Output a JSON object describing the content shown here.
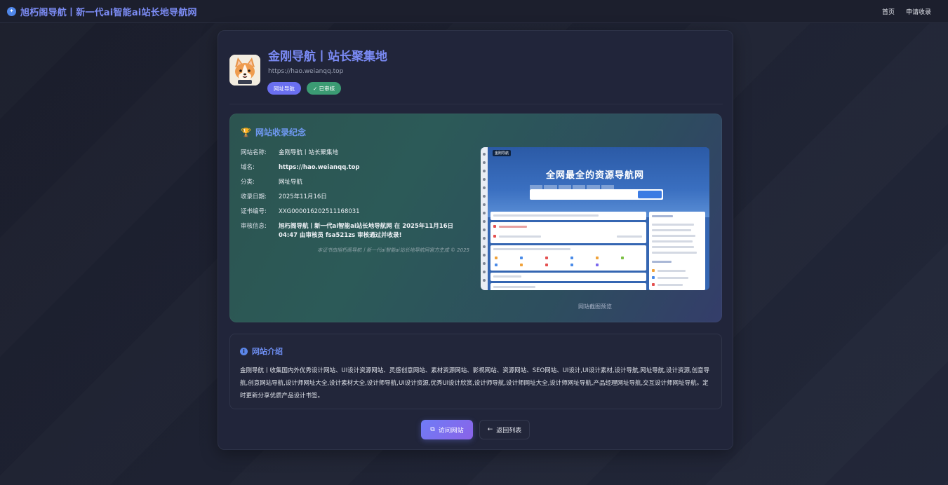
{
  "topbar": {
    "brand": "旭朽阁导航丨新一代ai智能ai站长地导航网",
    "nav": [
      "首页",
      "申请收录"
    ]
  },
  "site": {
    "title": "金刚导航丨站长聚集地",
    "url": "https://hao.weianqq.top",
    "tags": [
      "网址导航",
      "已审核"
    ]
  },
  "certificate": {
    "title": "网站收录纪念",
    "rows": [
      {
        "label": "网站名称:",
        "value": "金刚导航丨站长聚集地"
      },
      {
        "label": "域名:",
        "value": "https://hao.weianqq.top"
      },
      {
        "label": "分类:",
        "value": "网址导航"
      },
      {
        "label": "收录日期:",
        "value": "2025年11月16日"
      },
      {
        "label": "证书编号:",
        "value": "XXG000016202511168031"
      },
      {
        "label": "审核信息:",
        "value": "旭朽阁导航丨新一代ai智能ai站长地导航网 在 2025年11月16日 04:47 由审核员 fsa521zs 审核通过并收录!"
      }
    ],
    "footer": "本证书由旭朽阁导航丨新一代ai智能ai站长地导航网官方生成 © 2025",
    "preview": {
      "logo": "金刚导航",
      "headline": "全网最全的资源导航网",
      "caption": "网站截图预览"
    }
  },
  "intro": {
    "title": "网站介绍",
    "text": "金刚导航丨收集国内外优秀设计网站、UI设计资源网站、灵感创意网站、素材资源网站、影视网站、资源网站、SEO网站、UI设计,UI设计素材,设计导航,网址导航,设计资源,创意导航,创意网站导航,设计师网址大全,设计素材大全,设计师导航,UI设计资源,优秀UI设计欣赏,设计师导航,设计师网址大全,设计师网址导航,产品经理网址导航,交互设计师网址导航。定时更新分享优质产品设计书签。"
  },
  "actions": {
    "visit": "访问网站",
    "back": "返回列表"
  },
  "colors": {
    "accent": "#7a8af4",
    "tag_purple": "#6a6ff0",
    "tag_green": "#3b9b73",
    "cert_title": "#6e98f0"
  }
}
